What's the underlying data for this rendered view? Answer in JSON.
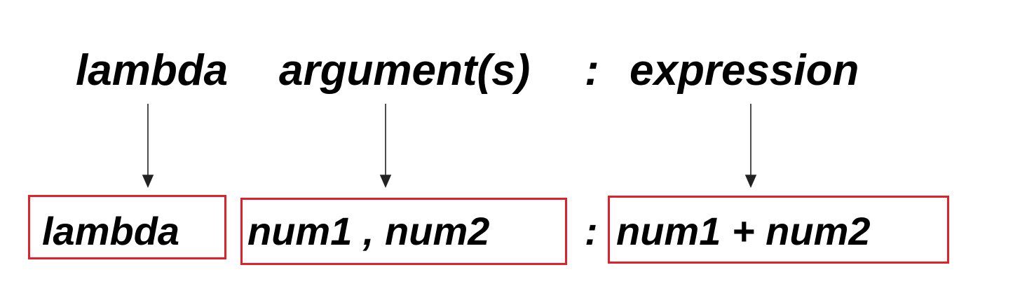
{
  "syntax": {
    "keyword": "lambda",
    "arguments": "argument(s)",
    "colon": ":",
    "expression": "expression"
  },
  "example": {
    "keyword": "lambda",
    "arguments": "num1 , num2",
    "colon": ":",
    "expression": "num1 + num2"
  },
  "colors": {
    "text": "#000000",
    "box_border": "#e0202b",
    "arrow": "#222222"
  }
}
